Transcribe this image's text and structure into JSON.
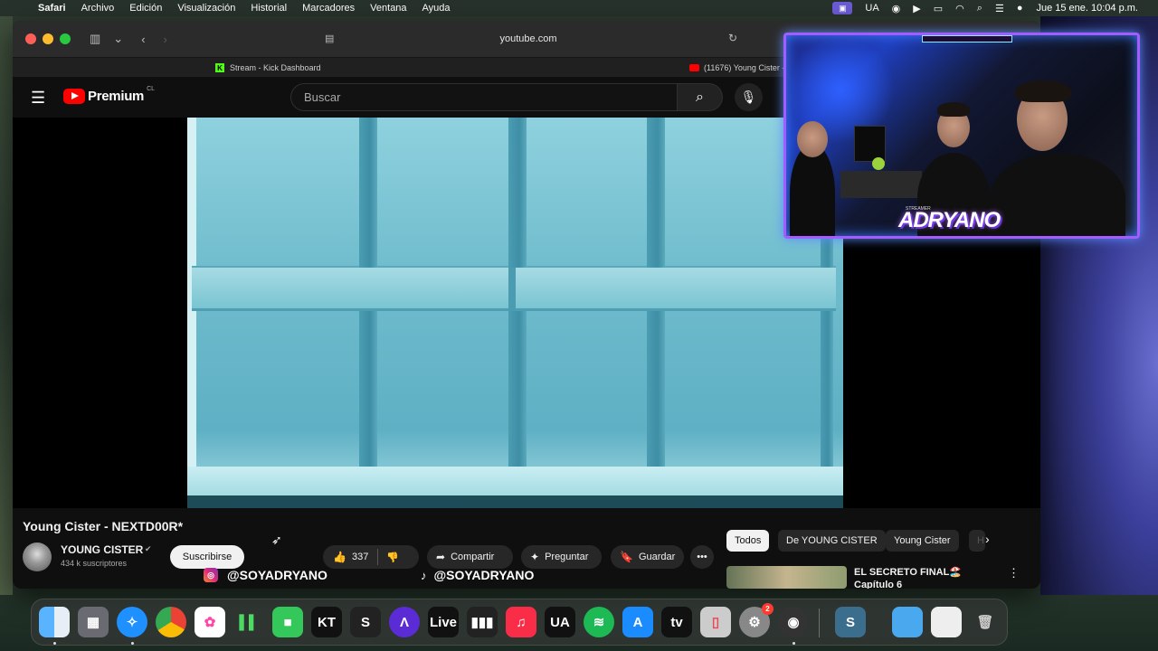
{
  "menubar": {
    "app": "Safari",
    "items": [
      "Archivo",
      "Edición",
      "Visualización",
      "Historial",
      "Marcadores",
      "Ventana",
      "Ayuda"
    ],
    "status_ua": "UA",
    "clock": "Jue 15 ene.  10:04 p.m."
  },
  "browser": {
    "url": "youtube.com",
    "tabs": [
      {
        "label": "Stream - Kick Dashboard"
      },
      {
        "label": "(11676) Young Cister -"
      }
    ]
  },
  "youtube": {
    "brand": "Premium",
    "country": "CL",
    "search_placeholder": "Buscar",
    "video": {
      "title": "Young Cister - NEXTD00R*",
      "channel": "YOUNG CISTER",
      "subscribers": "434 k suscriptores",
      "subscribe_label": "Suscribirse",
      "likes": "337",
      "share_label": "Compartir",
      "ask_label": "Preguntar",
      "save_label": "Guardar"
    },
    "chips": [
      "Todos",
      "De YOUNG CISTER",
      "Young Cister",
      "H"
    ],
    "recommendation": {
      "title": "EL SECRETO FINAL🏖️ Capítulo 6"
    }
  },
  "overlay": {
    "instagram": "@SOYADRYANO",
    "tiktok": "@SOYADRYANO",
    "streamer": "ADRYANO",
    "streamer_sub": "STREAMER"
  },
  "dock": {
    "live_label": "Live",
    "ua_label": "UA",
    "tv_label": "tv",
    "kt_label": "KT",
    "settings_badge": "2"
  },
  "colors": {
    "yt_red": "#ff0000",
    "webcam_border": "#a45cff",
    "kick_green": "#53fc18"
  }
}
